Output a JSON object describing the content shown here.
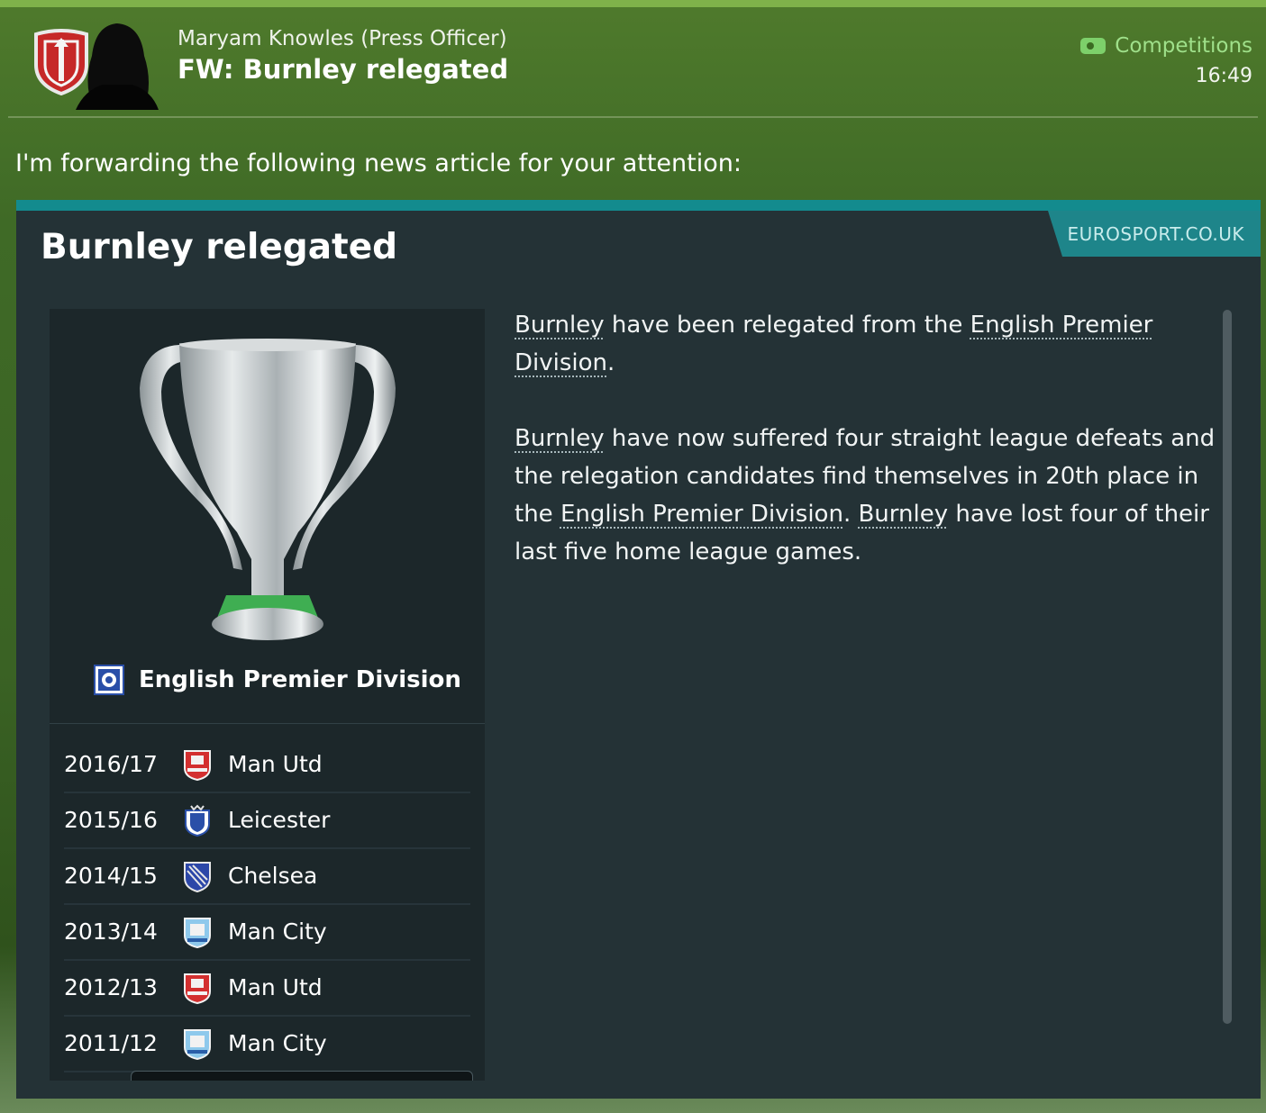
{
  "message": {
    "sender_name": "Maryam Knowles",
    "sender_role": "(Press Officer)",
    "subject": "FW: Burnley relegated",
    "category": "Competitions",
    "time": "16:49",
    "intro": "I'm forwarding the following news article for your attention:"
  },
  "article": {
    "source": "EUROSPORT.CO.UK",
    "headline": "Burnley relegated",
    "competition": "English Premier Division",
    "p1": {
      "a": "Burnley",
      "b": " have been relegated from the ",
      "c": "English Premier Division",
      "d": "."
    },
    "p2": {
      "a": "Burnley",
      "b": " have now suffered four straight league defeats and the relegation candidates find themselves in 20th place in the ",
      "c": "English Premier Division",
      "d": ". ",
      "e": "Burnley",
      "f": " have lost four of their last five home league games."
    }
  },
  "history": [
    {
      "season": "2016/17",
      "club": "Man Utd",
      "icon": "man-utd-crest-icon"
    },
    {
      "season": "2015/16",
      "club": "Leicester",
      "icon": "leicester-crest-icon"
    },
    {
      "season": "2014/15",
      "club": "Chelsea",
      "icon": "chelsea-crest-icon"
    },
    {
      "season": "2013/14",
      "club": "Man City",
      "icon": "man-city-crest-icon"
    },
    {
      "season": "2012/13",
      "club": "Man Utd",
      "icon": "man-utd-crest-icon"
    },
    {
      "season": "2011/12",
      "club": "Man City",
      "icon": "man-city-crest-icon"
    }
  ],
  "colors": {
    "accent_teal": "#138b8e",
    "category_green": "#9fe08a",
    "panel": "#243236"
  }
}
